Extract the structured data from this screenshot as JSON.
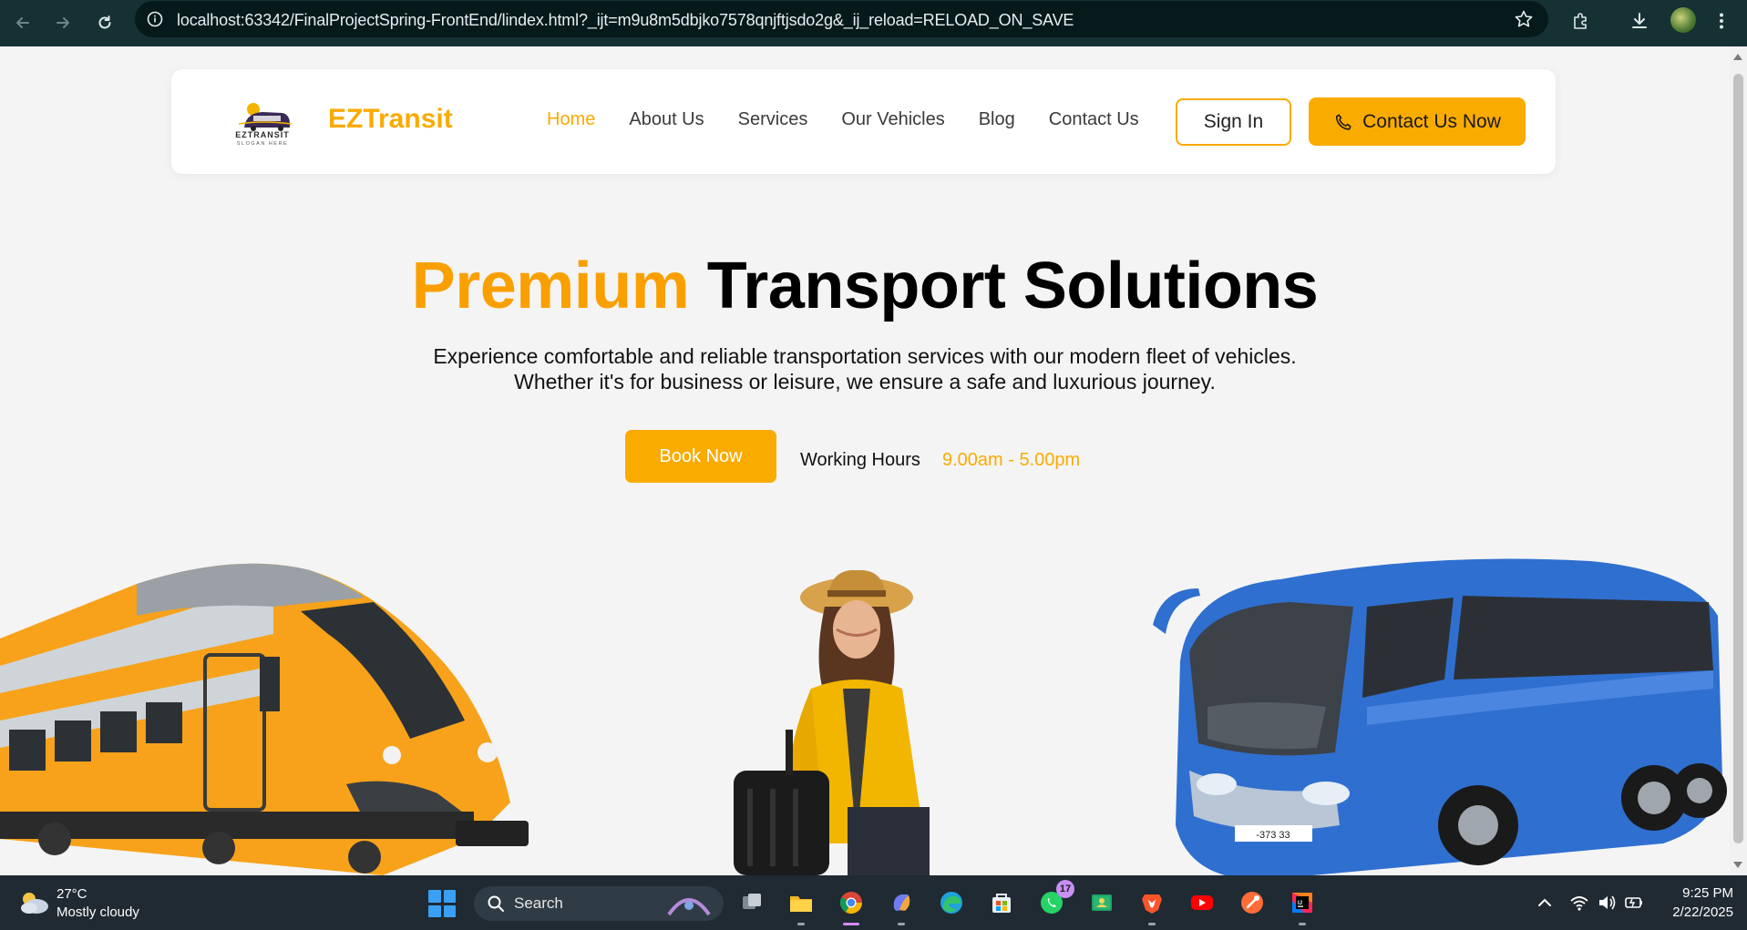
{
  "browser": {
    "url": "localhost:63342/FinalProjectSpring-FrontEnd/lindex.html?_ijt=m9u8m5dbjko7578qnjftjsdo2g&_ij_reload=RELOAD_ON_SAVE"
  },
  "navbar": {
    "logo_text": "EZTRANSIT",
    "logo_slogan": "SLOGAN HERE",
    "brand": "EZTransit",
    "links": [
      "Home",
      "About Us",
      "Services",
      "Our Vehicles",
      "Blog",
      "Contact Us"
    ],
    "active_link": "Home",
    "signin_label": "Sign In",
    "cta_label": "Contact Us Now"
  },
  "hero": {
    "title_accent": "Premium",
    "title_rest": "Transport Solutions",
    "desc_line1": "Experience comfortable and reliable transportation services with our modern fleet of vehicles.",
    "desc_line2": "Whether it's for business or leisure, we ensure a safe and luxurious journey.",
    "book_label": "Book Now",
    "hours_label": "Working Hours",
    "hours_value": "9.00am - 5.00pm"
  },
  "vehicles": {
    "bus_plate": "-373 33"
  },
  "colors": {
    "accent": "#f9ab00",
    "bus": "#2f6fd0",
    "train": "#f7a21a"
  },
  "taskbar": {
    "weather_temp": "27°C",
    "weather_desc": "Mostly cloudy",
    "search_label": "Search",
    "whatsapp_badge": "17",
    "clock_time": "9:25 PM",
    "clock_date": "2/22/2025"
  }
}
